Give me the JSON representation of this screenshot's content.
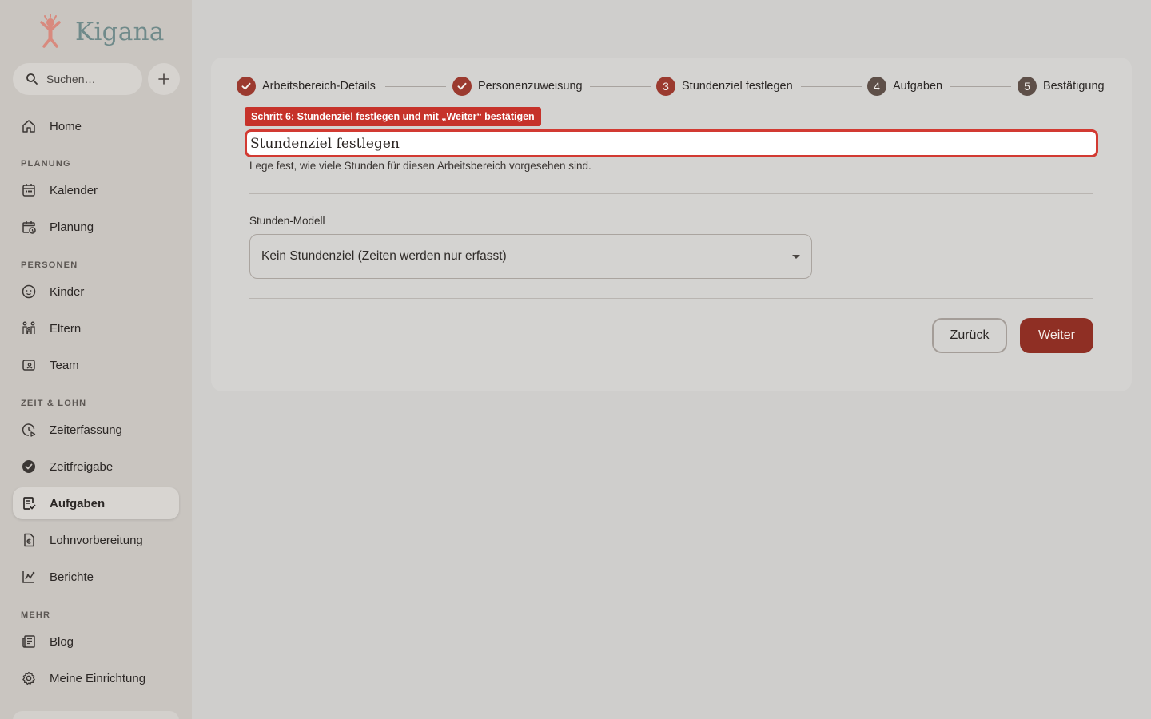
{
  "app": {
    "name": "Kigana"
  },
  "search": {
    "placeholder": "Suchen…"
  },
  "sidebar": {
    "home": "Home",
    "sections": {
      "planung": "PLANUNG",
      "personen": "PERSONEN",
      "zeit_lohn": "ZEIT & LOHN",
      "mehr": "MEHR"
    },
    "items": {
      "kalender": "Kalender",
      "planung": "Planung",
      "kinder": "Kinder",
      "eltern": "Eltern",
      "team": "Team",
      "zeiterfassung": "Zeiterfassung",
      "zeitfreigabe": "Zeitfreigabe",
      "aufgaben": "Aufgaben",
      "lohnvorbereitung": "Lohnvorbereitung",
      "berichte": "Berichte",
      "blog": "Blog",
      "meine_einrichtung": "Meine Einrichtung"
    },
    "active": "aufgaben"
  },
  "stepper": {
    "steps": [
      {
        "label": "Arbeitsbereich-Details",
        "state": "done"
      },
      {
        "label": "Personenzuweisung",
        "state": "done"
      },
      {
        "number": "3",
        "label": "Stundenziel festlegen",
        "state": "current"
      },
      {
        "number": "4",
        "label": "Aufgaben",
        "state": "todo"
      },
      {
        "number": "5",
        "label": "Bestätigung",
        "state": "todo"
      }
    ]
  },
  "tooltip": {
    "text": "Schritt 6: Stundenziel festlegen und mit „Weiter“ bestätigen"
  },
  "form": {
    "title": "Stundenziel festlegen",
    "subtitle": "Lege fest, wie viele Stunden für diesen Arbeitsbereich vorgesehen sind.",
    "model_label": "Stunden-Modell",
    "model_value": "Kein Stundenziel (Zeiten werden nur erfasst)"
  },
  "buttons": {
    "back": "Zurück",
    "next": "Weiter"
  },
  "colors": {
    "accent": "#9b3a2f",
    "primary_button": "#8f2f24",
    "highlight": "#d23a32",
    "logo_text": "#6f8a8a",
    "logo_icon": "#d88a7e"
  }
}
